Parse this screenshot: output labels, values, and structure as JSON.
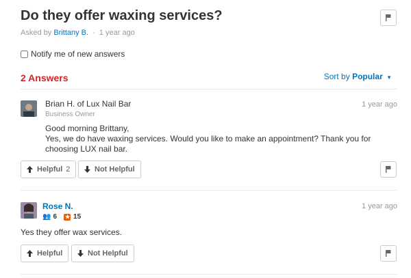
{
  "question": {
    "title": "Do they offer waxing services?",
    "asked_by_prefix": "Asked by",
    "asker": "Brittany B.",
    "separator": "·",
    "time": "1 year ago",
    "notify_label": "Notify me of new answers"
  },
  "answers_header": {
    "count_label": "2 Answers",
    "sort_prefix": "Sort by",
    "sort_value": "Popular"
  },
  "answers": [
    {
      "name": "Brian H. of Lux Nail Bar",
      "role": "Business Owner",
      "time": "1 year ago",
      "text_line1": "Good morning Brittany,",
      "text_line2": "Yes, we do have waxing services. Would you like to make an appointment? Thank you for",
      "text_line3": "choosing LUX nail bar.",
      "helpful_label": "Helpful",
      "helpful_count": "2",
      "not_helpful_label": "Not Helpful"
    },
    {
      "name": "Rose N.",
      "friends": "6",
      "reviews": "15",
      "time": "1 year ago",
      "text": "Yes they offer wax services.",
      "helpful_label": "Helpful",
      "not_helpful_label": "Not Helpful"
    }
  ],
  "colors": {
    "accent_red": "#d32323",
    "link_blue": "#0073bb",
    "review_orange": "#f15c00"
  }
}
